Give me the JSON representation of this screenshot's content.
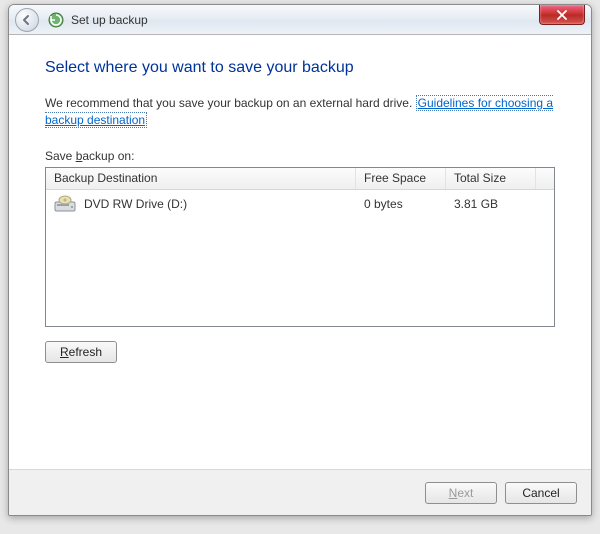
{
  "window": {
    "title": "Set up backup"
  },
  "content": {
    "heading": "Select where you want to save your backup",
    "recommend_prefix": "We recommend that you save your backup on an external hard drive. ",
    "guidelines_link": "Guidelines for choosing a backup destination",
    "save_label_prefix": "Save ",
    "save_label_underline": "b",
    "save_label_suffix": "ackup on:"
  },
  "table": {
    "headers": {
      "destination": "Backup Destination",
      "free": "Free Space",
      "size": "Total Size"
    },
    "rows": [
      {
        "icon": "dvd-drive-icon",
        "name": "DVD RW Drive (D:)",
        "free": "0 bytes",
        "size": "3.81 GB"
      }
    ]
  },
  "buttons": {
    "refresh_u": "R",
    "refresh_rest": "efresh",
    "next_u": "N",
    "next_rest": "ext",
    "cancel": "Cancel"
  }
}
